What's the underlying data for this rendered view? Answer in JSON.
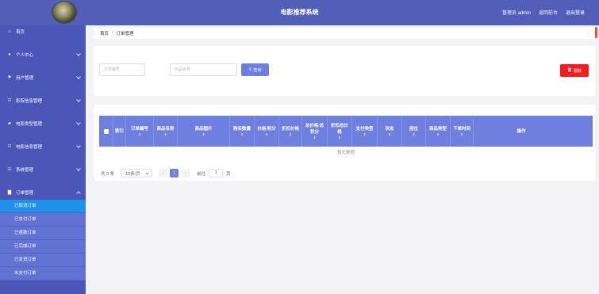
{
  "header": {
    "title": "电影推荐系统",
    "user_label": "管理员 admin",
    "back_label": "返回前台",
    "logout_label": "退出登录"
  },
  "sidebar": {
    "items": [
      {
        "label": "首页",
        "icon": "home-icon"
      },
      {
        "label": "个人中心",
        "icon": "user-icon"
      },
      {
        "label": "用户管理",
        "icon": "flag-icon"
      },
      {
        "label": "影院信息管理",
        "icon": "grid-icon"
      },
      {
        "label": "电影类型管理",
        "icon": "tag-icon"
      },
      {
        "label": "电影信息管理",
        "icon": "grid-icon"
      },
      {
        "label": "系统管理",
        "icon": "grid-icon"
      },
      {
        "label": "订单管理",
        "icon": "chart-icon"
      }
    ],
    "submenu": [
      {
        "label": "已取消订单",
        "active": true
      },
      {
        "label": "已支付订单",
        "active": false
      },
      {
        "label": "已退款订单",
        "active": false
      },
      {
        "label": "已完成订单",
        "active": false
      },
      {
        "label": "已发货订单",
        "active": false
      },
      {
        "label": "未支付订单",
        "active": false
      }
    ]
  },
  "breadcrumb": {
    "home": "首页",
    "separator": "/",
    "current": "订单管理"
  },
  "search": {
    "order_no_placeholder": "订单编号",
    "product_name_placeholder": "商品名称",
    "search_label": "查询",
    "delete_label": "删除"
  },
  "table": {
    "columns": [
      {
        "label": "",
        "sortable": false
      },
      {
        "label": "索引",
        "sortable": false
      },
      {
        "label": "订单编号",
        "sortable": true
      },
      {
        "label": "商品名称",
        "sortable": true
      },
      {
        "label": "商品图片",
        "sortable": true
      },
      {
        "label": "购买数量",
        "sortable": true
      },
      {
        "label": "价格/积分",
        "sortable": true
      },
      {
        "label": "折扣价格",
        "sortable": true
      },
      {
        "label": "总价格/总积分",
        "sortable": true
      },
      {
        "label": "折扣总价格",
        "sortable": true
      },
      {
        "label": "支付类型",
        "sortable": true
      },
      {
        "label": "状态",
        "sortable": true
      },
      {
        "label": "座位",
        "sortable": true
      },
      {
        "label": "商品类型",
        "sortable": true
      },
      {
        "label": "下单时间",
        "sortable": true
      },
      {
        "label": "操作",
        "sortable": false
      }
    ],
    "empty_text": "暂无数据"
  },
  "pagination": {
    "total_text": "共 0 条",
    "page_size": "10条/页",
    "current_page": "1",
    "goto_label": "前往",
    "goto_value": "1",
    "page_unit": "页"
  },
  "colors": {
    "header_bg": "#525fb8",
    "sidebar_bg": "#4a57b8",
    "accent": "#6f7fe0",
    "active_item": "#1e90e8",
    "danger": "#f31d1d"
  }
}
